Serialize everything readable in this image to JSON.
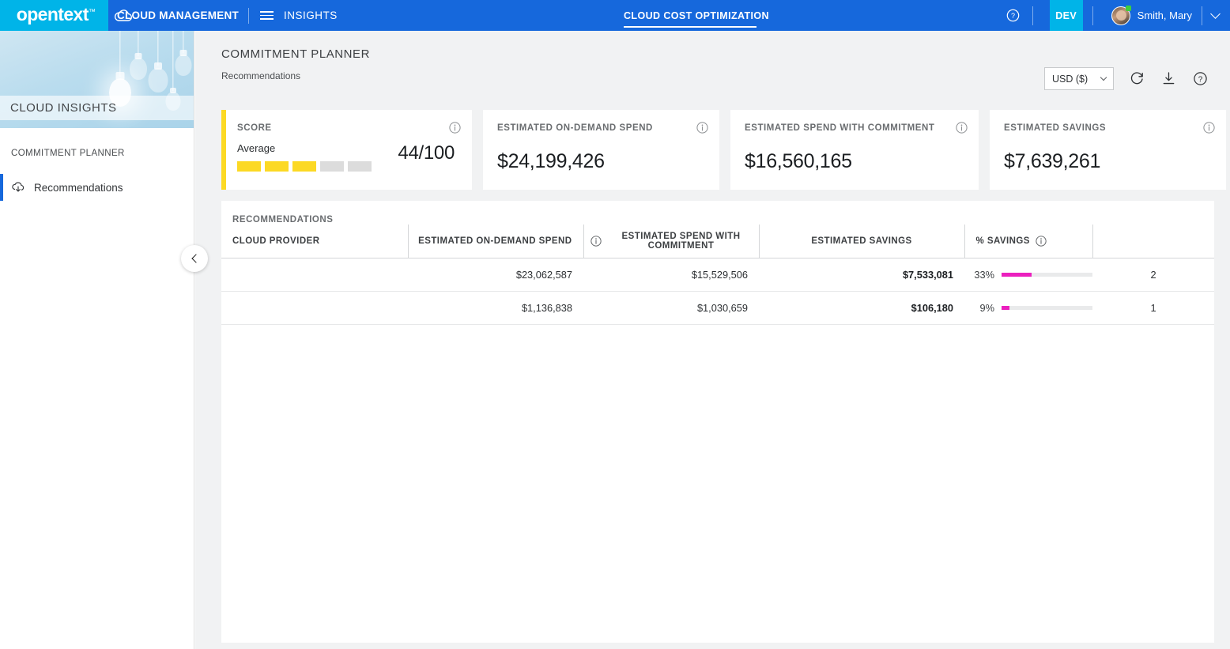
{
  "header": {
    "brand": "opentext",
    "brand_tm": "™",
    "suite": "CLOUD MANAGEMENT",
    "cloud_icon": "cloud-icon",
    "menu_icon": "hamburger-menu-icon",
    "module": "INSIGHTS",
    "active_tab": "CLOUD COST OPTIMIZATION",
    "help_icon": "help-circle-icon",
    "environment_badge": "DEV",
    "user_name": "Smith, Mary",
    "avatar": "user-avatar",
    "user_menu_icon": "chevron-down-icon"
  },
  "sidebar": {
    "product_title": "CLOUD INSIGHTS",
    "section_label": "COMMITMENT PLANNER",
    "items": [
      {
        "label": "Recommendations",
        "icon": "cloud-download-icon",
        "active": true
      }
    ],
    "collapse_icon": "chevron-left-icon"
  },
  "page": {
    "title": "COMMITMENT PLANNER",
    "breadcrumb": "Recommendations",
    "currency": "USD ($)",
    "currency_chevron": "chevron-down-icon",
    "refresh_icon": "refresh-icon",
    "download_icon": "download-icon",
    "help_icon": "help-circle-icon"
  },
  "kpis": [
    {
      "title": "SCORE",
      "info_icon": "info-icon",
      "accent_color": "#fcd924",
      "score_label": "Average",
      "score_value": "44/100",
      "segments_total": 5,
      "segments_filled": 3
    },
    {
      "title": "ESTIMATED ON-DEMAND SPEND",
      "info_icon": "info-icon",
      "value": "$24,199,426"
    },
    {
      "title": "ESTIMATED SPEND WITH COMMITMENT",
      "info_icon": "info-icon",
      "value": "$16,560,165"
    },
    {
      "title": "ESTIMATED SAVINGS",
      "info_icon": "info-icon",
      "value": "$7,639,261"
    }
  ],
  "table": {
    "panel_title": "RECOMMENDATIONS",
    "columns": [
      {
        "label": "CLOUD PROVIDER",
        "align": "left"
      },
      {
        "label": "ESTIMATED ON-DEMAND SPEND",
        "align": "right",
        "info_icon": "info-icon"
      },
      {
        "label": "ESTIMATED SPEND WITH COMMITMENT",
        "align": "right"
      },
      {
        "label": "ESTIMATED SAVINGS",
        "align": "right"
      },
      {
        "label": "% SAVINGS",
        "align": "left",
        "info_icon": "info-icon"
      },
      {
        "label": "",
        "align": "center"
      }
    ],
    "bar_color": "#eb1fbe",
    "rows": [
      {
        "provider": "",
        "on_demand": "$23,062,587",
        "with_commitment": "$15,529,506",
        "savings": "$7,533,081",
        "pct_savings": "33%",
        "pct_value": 33,
        "count": "2"
      },
      {
        "provider": "",
        "on_demand": "$1,136,838",
        "with_commitment": "$1,030,659",
        "savings": "$106,180",
        "pct_savings": "9%",
        "pct_value": 9,
        "count": "1"
      }
    ]
  }
}
